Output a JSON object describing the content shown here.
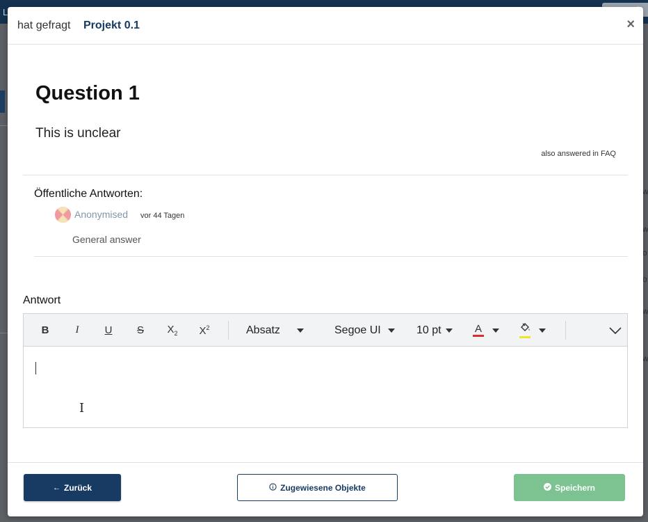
{
  "background": {
    "left_fragment": "L",
    "right_fragment": "S",
    "right_edge_fragments": [
      "w",
      "w",
      "o",
      "o",
      "w",
      "w"
    ]
  },
  "header": {
    "asked_label": "hat gefragt",
    "project_name": "Projekt 0.1",
    "close_symbol": "×"
  },
  "question": {
    "title": "Question 1",
    "text": "This is unclear",
    "faq_note": "also answered in FAQ"
  },
  "public_answers": {
    "label": "Öffentliche Antworten:",
    "items": [
      {
        "author": "Anonymised",
        "time_ago": "vor 44 Tagen",
        "text": "General answer"
      }
    ]
  },
  "answer_editor": {
    "label": "Antwort",
    "toolbar": {
      "bold": "B",
      "italic": "I",
      "underline": "U",
      "strikethrough": "S",
      "subscript": "X",
      "subscript_digit": "2",
      "superscript": "X",
      "superscript_digit": "2",
      "block_format": "Absatz",
      "font_family": "Segoe UI",
      "font_size": "10 pt",
      "text_color_letter": "A",
      "text_color": "#d9302c",
      "highlight_color": "#f2e529"
    },
    "content": ""
  },
  "footer": {
    "back_label": "Zurück",
    "back_arrow": "←",
    "assigned_label": "Zugewiesene Objekte",
    "save_label": "Speichern"
  },
  "colors": {
    "primary": "#173b63",
    "success": "#7cc391",
    "link_muted": "#8296ab"
  }
}
